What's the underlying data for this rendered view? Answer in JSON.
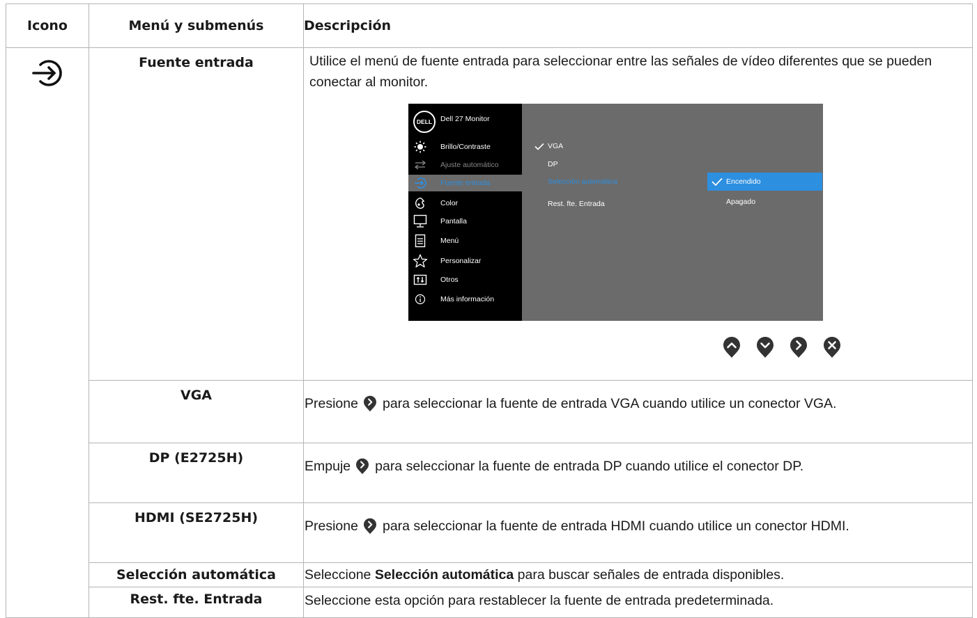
{
  "headers": {
    "icon": "Icono",
    "menu": "Menú y submenús",
    "desc": "Descripción"
  },
  "rows": {
    "fuente": {
      "name": "Fuente entrada",
      "desc": "Utilice el menú de fuente entrada para seleccionar entre las señales de vídeo diferentes que se pueden conectar al monitor."
    },
    "vga": {
      "name": "VGA",
      "pre": "Presione",
      "post": "para seleccionar la fuente de entrada VGA cuando utilice un conector VGA."
    },
    "dp": {
      "name": "DP (E2725H)",
      "pre": "Empuje",
      "post": "para seleccionar la fuente de entrada DP cuando utilice el conector DP."
    },
    "hdmi": {
      "name": "HDMI (SE2725H)",
      "pre": "Presione",
      "post": "para seleccionar la fuente de entrada HDMI cuando utilice un conector HDMI."
    },
    "auto": {
      "name": "Selección automática",
      "pre": "Seleccione",
      "bold": "Selección automática",
      "post": "para buscar señales de entrada disponibles."
    },
    "rest": {
      "name": "Rest. fte. Entrada",
      "desc": "Seleccione esta opción para restablecer la fuente de entrada predeterminada."
    }
  },
  "osd": {
    "logo": "DELL",
    "title": "Dell 27 Monitor",
    "menu": [
      {
        "label": "Brillo/Contraste",
        "icon": "sun-icon"
      },
      {
        "label": "Ajuste automático",
        "icon": "auto-adjust-icon"
      },
      {
        "label": "Fuente entrada",
        "icon": "input-source-icon"
      },
      {
        "label": "Color",
        "icon": "color-palette-icon"
      },
      {
        "label": "Pantalla",
        "icon": "display-icon"
      },
      {
        "label": "Menú",
        "icon": "menu-list-icon"
      },
      {
        "label": "Personalizar",
        "icon": "star-icon"
      },
      {
        "label": "Otros",
        "icon": "sliders-icon"
      },
      {
        "label": "Más información",
        "icon": "info-icon"
      }
    ],
    "options": [
      "VGA",
      "DP",
      "Selección automática",
      "Rest. fte. Entrada"
    ],
    "sub": [
      "Encendido",
      "Apagado"
    ],
    "colors": {
      "accent": "#2d8fe0",
      "panel": "#6b6b6b",
      "sidebar": "#000000"
    }
  }
}
